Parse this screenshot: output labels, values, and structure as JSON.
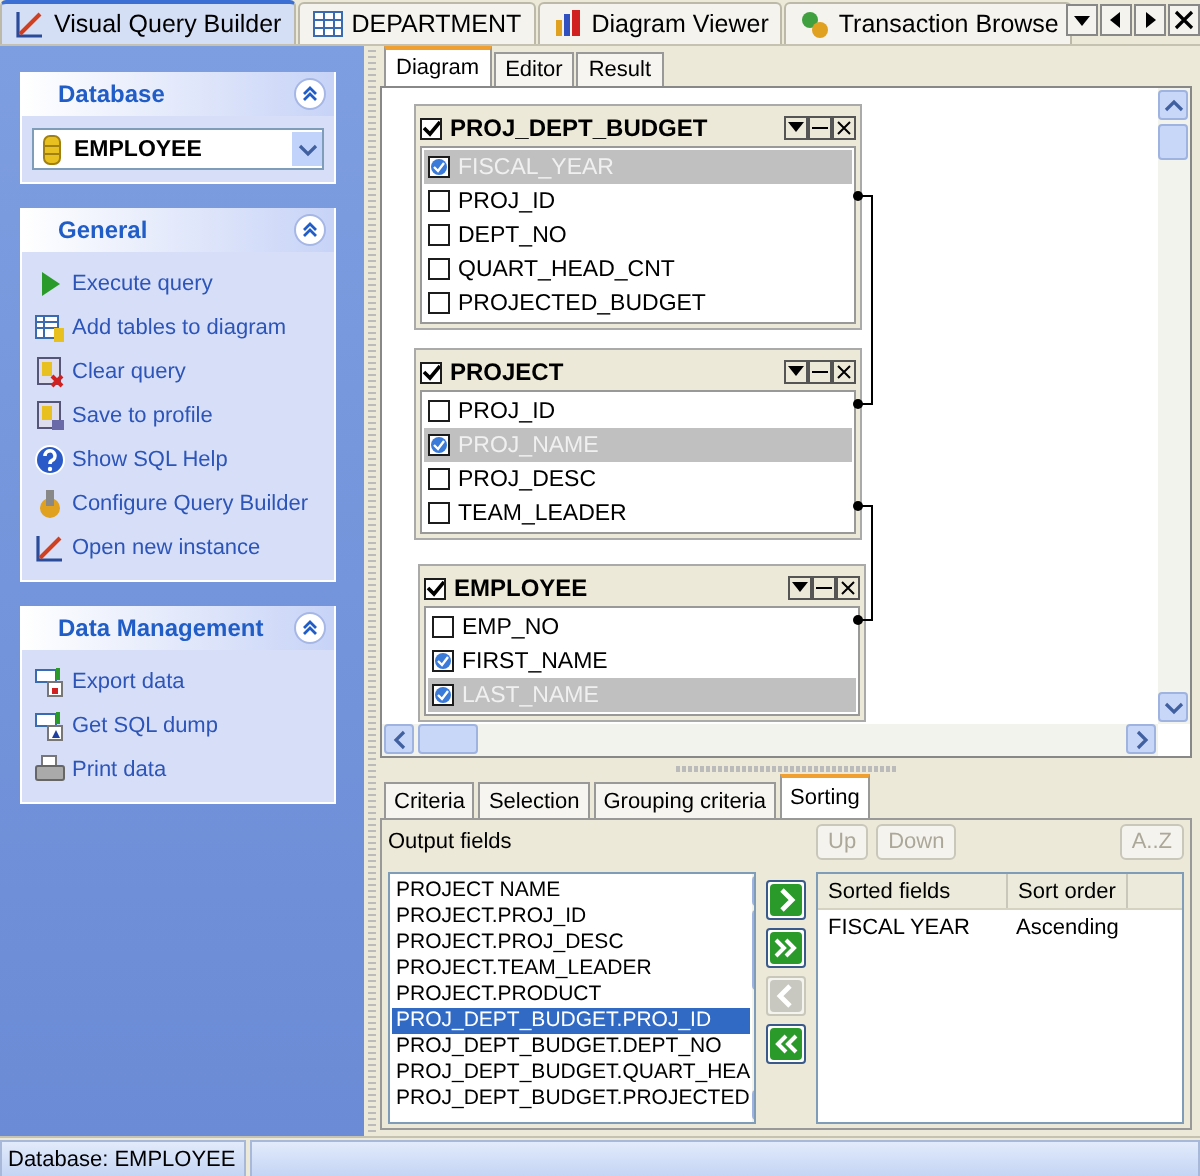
{
  "main_tabs": [
    {
      "label": "Visual Query Builder",
      "selected": true
    },
    {
      "label": "DEPARTMENT",
      "selected": false
    },
    {
      "label": "Diagram Viewer",
      "selected": false
    },
    {
      "label": "Transaction Browse",
      "selected": false
    }
  ],
  "sidebar": [
    {
      "kind": "database",
      "title": "Database",
      "value": "EMPLOYEE"
    },
    {
      "kind": "links",
      "title": "General",
      "items": [
        "Execute query",
        "Add tables to diagram",
        "Clear query",
        "Save to profile",
        "Show SQL Help",
        "Configure Query Builder",
        "Open new instance"
      ]
    },
    {
      "kind": "links",
      "title": "Data Management",
      "items": [
        "Export data",
        "Get SQL dump",
        "Print data"
      ]
    }
  ],
  "editor_tabs": [
    {
      "label": "Diagram",
      "selected": true
    },
    {
      "label": "Editor",
      "selected": false
    },
    {
      "label": "Result",
      "selected": false
    }
  ],
  "diagram": {
    "tables": [
      {
        "name": "PROJ_DEPT_BUDGET",
        "checked": true,
        "fields": [
          {
            "name": "FISCAL_YEAR",
            "checked": true,
            "selected": true
          },
          {
            "name": "PROJ_ID",
            "checked": false,
            "selected": false
          },
          {
            "name": "DEPT_NO",
            "checked": false,
            "selected": false
          },
          {
            "name": "QUART_HEAD_CNT",
            "checked": false,
            "selected": false
          },
          {
            "name": "PROJECTED_BUDGET",
            "checked": false,
            "selected": false
          }
        ]
      },
      {
        "name": "PROJECT",
        "checked": true,
        "fields": [
          {
            "name": "PROJ_ID",
            "checked": false,
            "selected": false
          },
          {
            "name": "PROJ_NAME",
            "checked": true,
            "selected": true
          },
          {
            "name": "PROJ_DESC",
            "checked": false,
            "selected": false
          },
          {
            "name": "TEAM_LEADER",
            "checked": false,
            "selected": false
          }
        ]
      },
      {
        "name": "EMPLOYEE",
        "checked": true,
        "fields": [
          {
            "name": "EMP_NO",
            "checked": false,
            "selected": false
          },
          {
            "name": "FIRST_NAME",
            "checked": true,
            "selected": false
          },
          {
            "name": "LAST_NAME",
            "checked": true,
            "selected": true
          }
        ]
      }
    ]
  },
  "bottom_tabs": [
    {
      "label": "Criteria",
      "selected": false
    },
    {
      "label": "Selection",
      "selected": false
    },
    {
      "label": "Grouping criteria",
      "selected": false
    },
    {
      "label": "Sorting",
      "selected": true
    }
  ],
  "sorting": {
    "output_label": "Output fields",
    "output_fields": [
      {
        "text": "PROJECT NAME",
        "selected": false
      },
      {
        "text": "PROJECT.PROJ_ID",
        "selected": false
      },
      {
        "text": "PROJECT.PROJ_DESC",
        "selected": false
      },
      {
        "text": "PROJECT.TEAM_LEADER",
        "selected": false
      },
      {
        "text": "PROJECT.PRODUCT",
        "selected": false
      },
      {
        "text": "PROJ_DEPT_BUDGET.PROJ_ID",
        "selected": true
      },
      {
        "text": "PROJ_DEPT_BUDGET.DEPT_NO",
        "selected": false
      },
      {
        "text": "PROJ_DEPT_BUDGET.QUART_HEA",
        "selected": false
      },
      {
        "text": "PROJ_DEPT_BUDGET.PROJECTED",
        "selected": false
      }
    ],
    "move_buttons": [
      {
        "kind": "add",
        "disabled": false
      },
      {
        "kind": "add_all",
        "disabled": false
      },
      {
        "kind": "remove",
        "disabled": true
      },
      {
        "kind": "remove_all",
        "disabled": false
      }
    ],
    "order_buttons": [
      {
        "label": "Up",
        "disabled": true
      },
      {
        "label": "Down",
        "disabled": true
      },
      {
        "label": "A..Z",
        "disabled": true
      }
    ],
    "sorted_columns": [
      "Sorted fields",
      "Sort order"
    ],
    "sorted_rows": [
      [
        "FISCAL YEAR",
        "Ascending"
      ]
    ]
  },
  "status_bar": {
    "text": "Database: EMPLOYEE"
  }
}
